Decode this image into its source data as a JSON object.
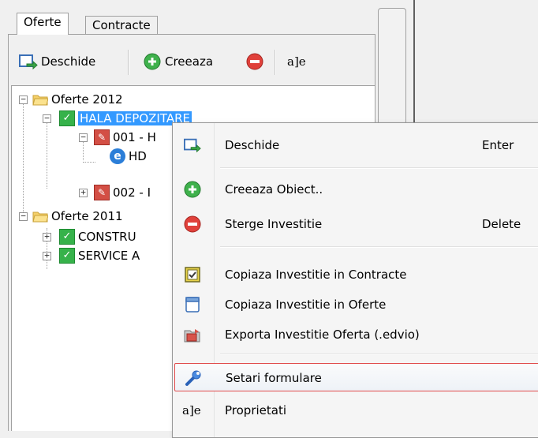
{
  "tabs": [
    {
      "label": "Oferte",
      "active": true
    },
    {
      "label": "Contracte",
      "active": false
    }
  ],
  "toolbar": {
    "open_label": "Deschide",
    "create_label": "Creeaza",
    "rename_glyph": "a]e"
  },
  "tree": {
    "root1": "Oferte 2012",
    "root1_child": "HALA DEPOZITARE",
    "offer_001": "001 - H",
    "hd_item": "HD",
    "offer_002": "002 - I",
    "root2": "Oferte 2011",
    "root2_child1": "CONSTRU",
    "root2_child2": "SERVICE A"
  },
  "context_menu": {
    "items": [
      {
        "label": "Deschide",
        "shortcut": "Enter",
        "icon": "open-arrow-icon"
      },
      {
        "label": "Creeaza Obiect..",
        "shortcut": "",
        "icon": "add-green-icon"
      },
      {
        "label": "Sterge Investitie",
        "shortcut": "Delete",
        "icon": "delete-red-icon"
      },
      {
        "label": "Copiaza Investitie in Contracte",
        "shortcut": "",
        "icon": "checkbox-copy-icon"
      },
      {
        "label": "Copiaza Investitie in Oferte",
        "shortcut": "",
        "icon": "window-copy-icon"
      },
      {
        "label": "Exporta Investitie Oferta (.edvio)",
        "shortcut": "",
        "icon": "export-folder-icon"
      },
      {
        "label": "Setari formulare",
        "shortcut": "",
        "icon": "wrench-icon"
      },
      {
        "label": "Proprietati",
        "shortcut": "",
        "icon": "properties-icon",
        "glyph": "a]e"
      }
    ]
  },
  "colors": {
    "selection": "#3399ff",
    "hover_border": "#e04b4b",
    "green": "#36b24a",
    "red": "#d34f45"
  }
}
